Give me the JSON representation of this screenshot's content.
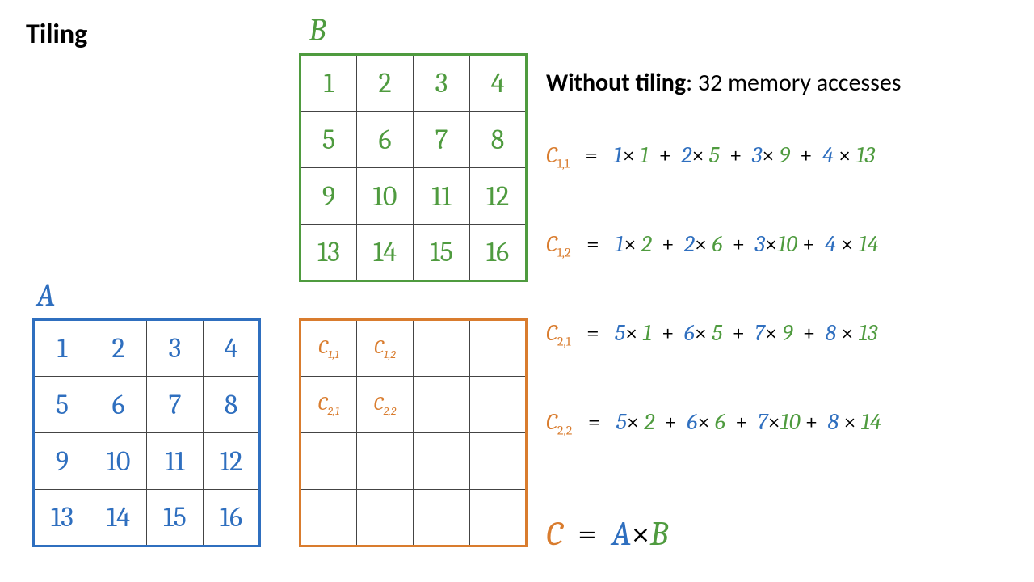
{
  "title": "Tiling",
  "labels": {
    "A": "A",
    "B": "B",
    "C": "C"
  },
  "headline_bold": "Without tiling",
  "headline_rest": ": 32 memory accesses",
  "matrix_A": [
    [
      "1",
      "2",
      "3",
      "4"
    ],
    [
      "5",
      "6",
      "7",
      "8"
    ],
    [
      "9",
      "10",
      "11",
      "12"
    ],
    [
      "13",
      "14",
      "15",
      "16"
    ]
  ],
  "matrix_B": [
    [
      "1",
      "2",
      "3",
      "4"
    ],
    [
      "5",
      "6",
      "7",
      "8"
    ],
    [
      "9",
      "10",
      "11",
      "12"
    ],
    [
      "13",
      "14",
      "15",
      "16"
    ]
  ],
  "matrix_C": [
    [
      "C1,1",
      "C1,2",
      "",
      ""
    ],
    [
      "C2,1",
      "C2,2",
      "",
      ""
    ],
    [
      "",
      "",
      "",
      ""
    ],
    [
      "",
      "",
      "",
      ""
    ]
  ],
  "equations": [
    {
      "lhs_sub": "1,1",
      "terms": [
        [
          "1",
          "1"
        ],
        [
          "2",
          "5"
        ],
        [
          "3",
          "9"
        ],
        [
          "4",
          "13"
        ]
      ]
    },
    {
      "lhs_sub": "1,2",
      "terms": [
        [
          "1",
          "2"
        ],
        [
          "2",
          "6"
        ],
        [
          "3",
          "10"
        ],
        [
          "4",
          "14"
        ]
      ]
    },
    {
      "lhs_sub": "2,1",
      "terms": [
        [
          "5",
          "1"
        ],
        [
          "6",
          "5"
        ],
        [
          "7",
          "9"
        ],
        [
          "8",
          "13"
        ]
      ]
    },
    {
      "lhs_sub": "2,2",
      "terms": [
        [
          "5",
          "2"
        ],
        [
          "6",
          "6"
        ],
        [
          "7",
          "10"
        ],
        [
          "8",
          "14"
        ]
      ]
    }
  ],
  "result_equation": {
    "lhs": "C",
    "mid": "A",
    "rhs": "B",
    "eq": "=",
    "mul": "×"
  },
  "ops": {
    "eq": "=",
    "plus": "+",
    "mul": "×"
  },
  "chart_data": {
    "type": "table",
    "description": "Matrix multiplication tiling illustration showing C = A × B with 4×4 matrices A and B (values 1–16 row-major). The top-left 2×2 block of C is computed; example without tiling requires 32 memory accesses.",
    "A": [
      [
        1,
        2,
        3,
        4
      ],
      [
        5,
        6,
        7,
        8
      ],
      [
        9,
        10,
        11,
        12
      ],
      [
        13,
        14,
        15,
        16
      ]
    ],
    "B": [
      [
        1,
        2,
        3,
        4
      ],
      [
        5,
        6,
        7,
        8
      ],
      [
        9,
        10,
        11,
        12
      ],
      [
        13,
        14,
        15,
        16
      ]
    ],
    "C_computed_cells": [
      "C1,1",
      "C1,2",
      "C2,1",
      "C2,2"
    ],
    "memory_accesses_without_tiling": 32,
    "dot_products": {
      "C1,1": {
        "a_row": [
          1,
          2,
          3,
          4
        ],
        "b_col": [
          1,
          5,
          9,
          13
        ]
      },
      "C1,2": {
        "a_row": [
          1,
          2,
          3,
          4
        ],
        "b_col": [
          2,
          6,
          10,
          14
        ]
      },
      "C2,1": {
        "a_row": [
          5,
          6,
          7,
          8
        ],
        "b_col": [
          1,
          5,
          9,
          13
        ]
      },
      "C2,2": {
        "a_row": [
          5,
          6,
          7,
          8
        ],
        "b_col": [
          2,
          6,
          10,
          14
        ]
      }
    }
  }
}
